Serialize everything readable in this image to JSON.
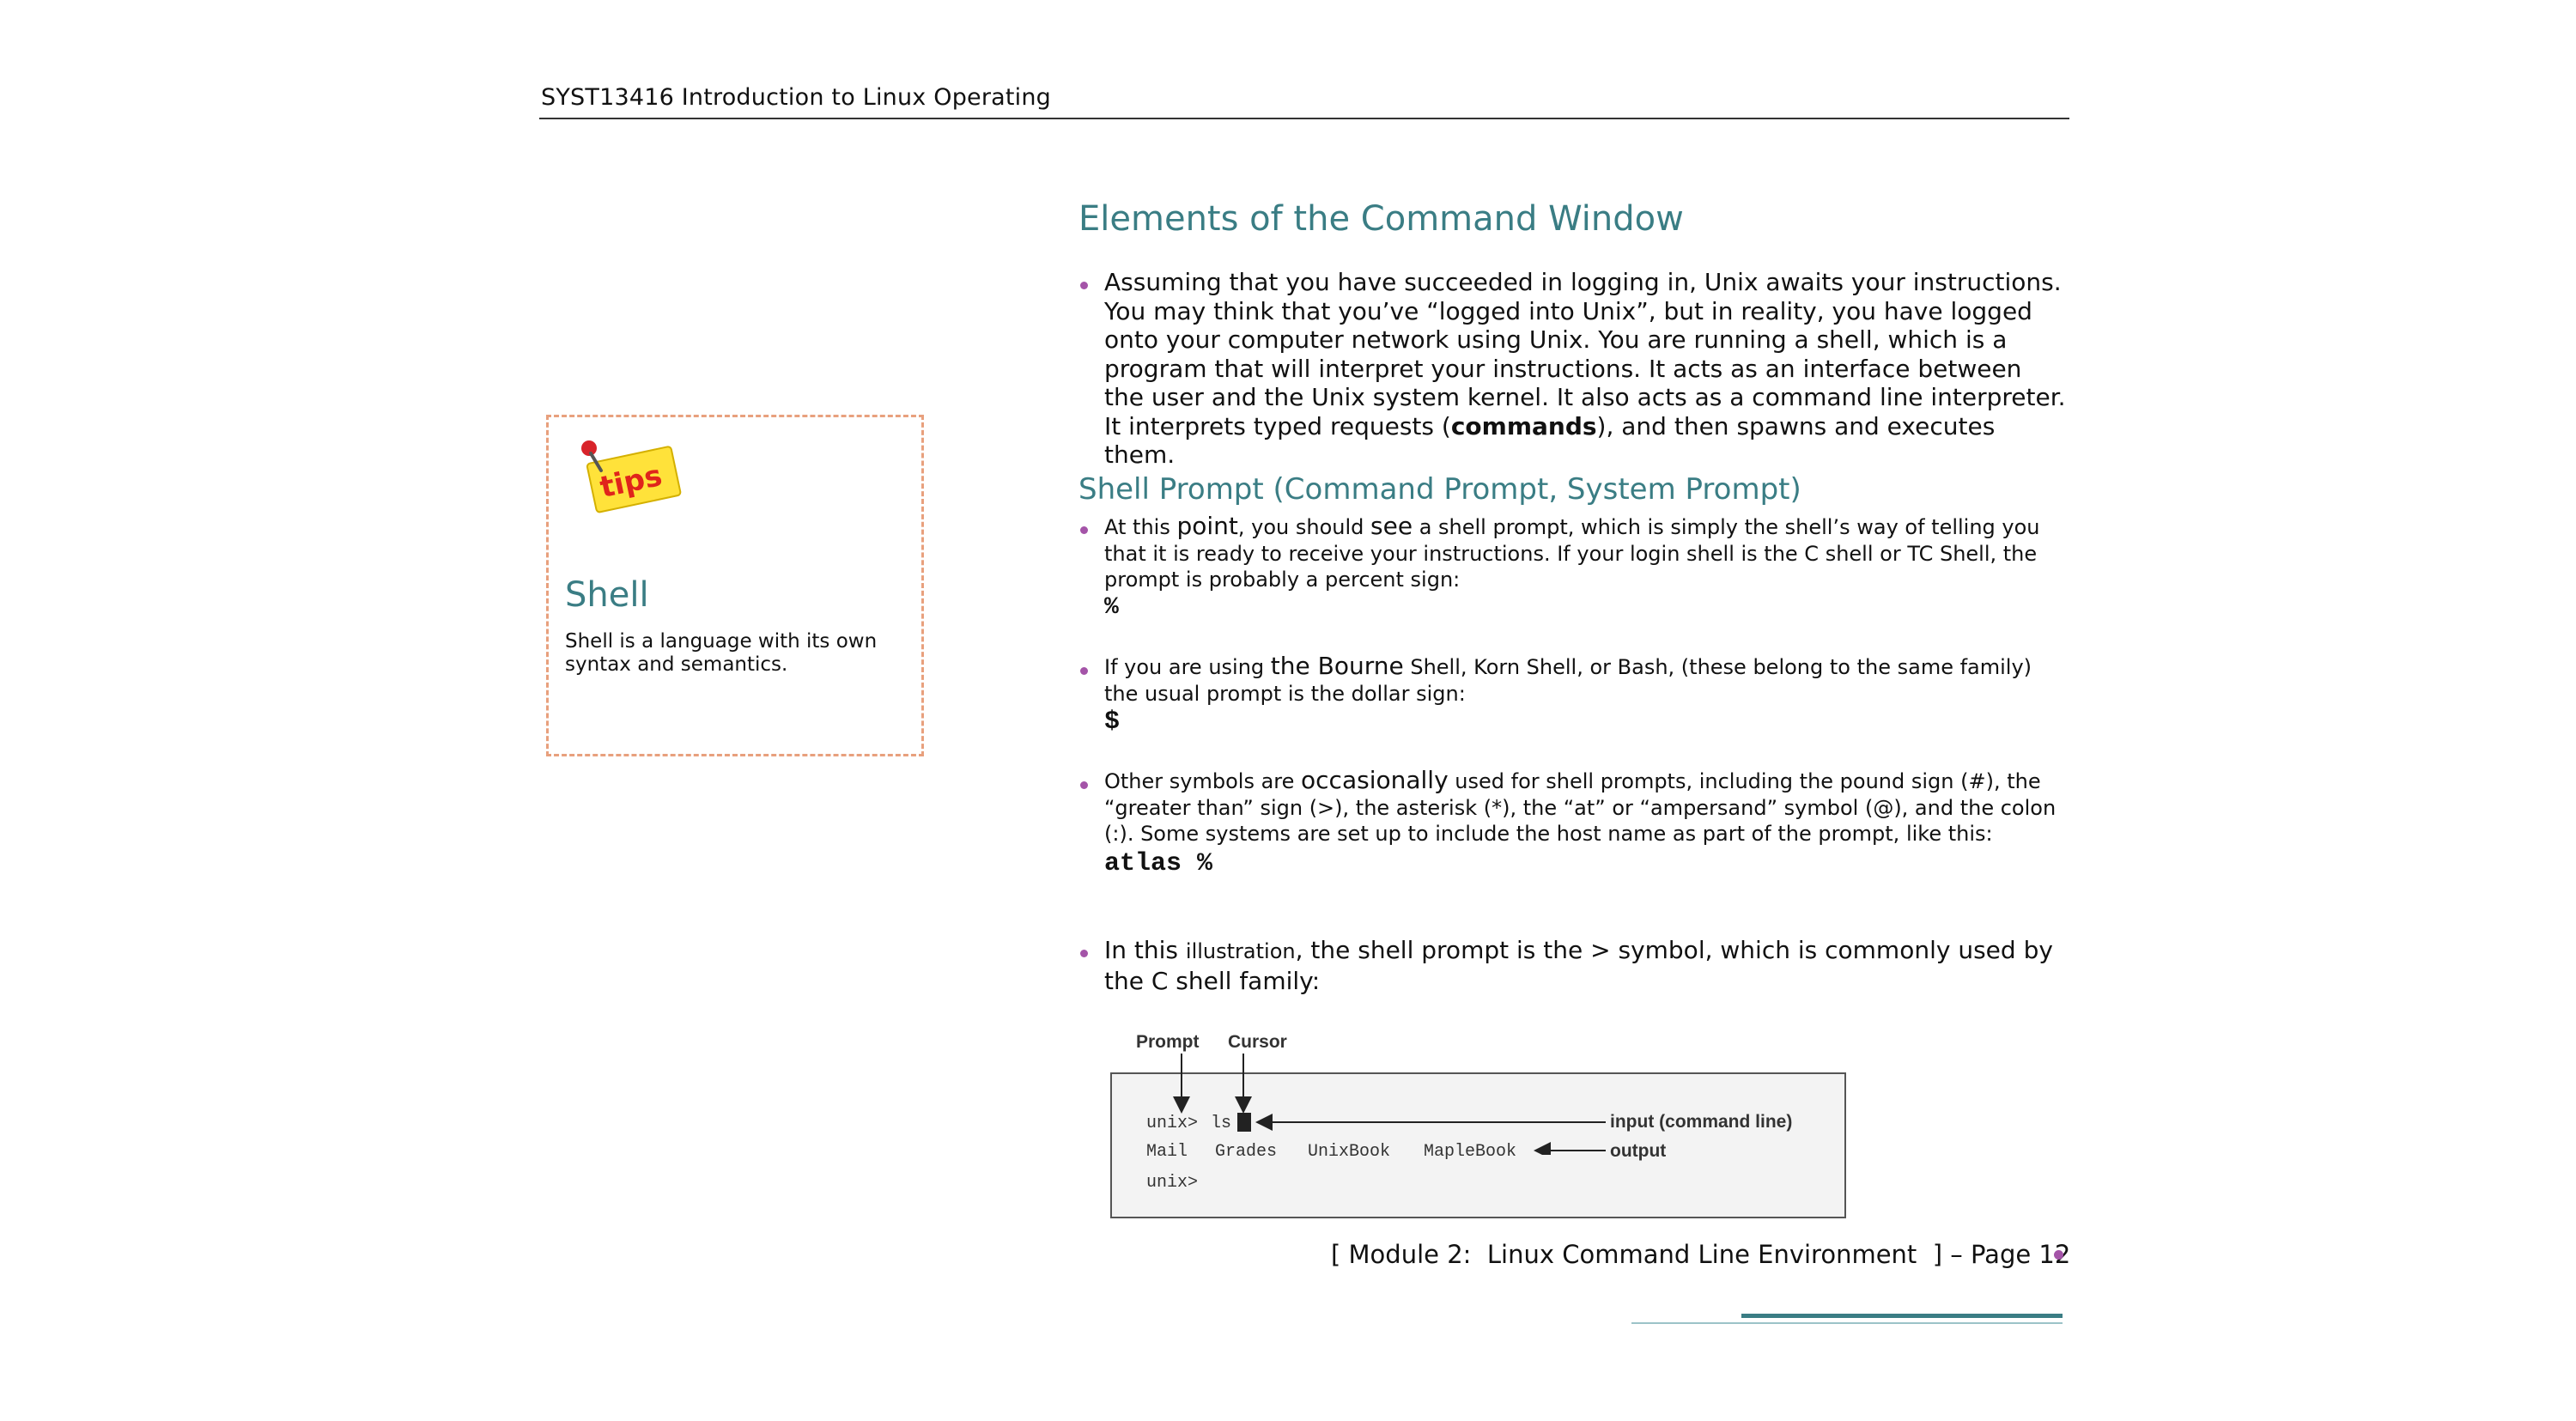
{
  "header": {
    "title": "SYST13416 Introduction to Linux Operating"
  },
  "sidebar": {
    "icon": "tips-sticky-note-icon",
    "icon_text": "tips",
    "heading": "Shell",
    "text": "Shell is a language with its own syntax and semantics."
  },
  "main": {
    "heading": "Elements of the Command Window",
    "intro": {
      "before": "Assuming that you have succeeded in logging in, Unix awaits your instructions. You may think that you’ve “logged into Unix”, but in reality, you have logged onto your computer network using Unix. You are running a shell, which is a program that will interpret your instructions. It acts as an interface between the user and the Unix system kernel. It also acts as a command line interpreter. It interprets typed requests (",
      "bold": "commands",
      "after": "), and then spawns and executes them."
    },
    "subheading": "Shell Prompt (Command Prompt, System Prompt)",
    "bullet1": {
      "t1": "At this ",
      "t2": "point",
      "t3": ", you should ",
      "t4": "see",
      "t5": " a shell prompt, which is simply the shell’s way of telling you that it is ready to receive your instructions. If your login shell is the C shell or TC Shell, the prompt is probably a percent sign:",
      "code": "%"
    },
    "bullet2": {
      "t1": "If you are using ",
      "t2": "the Bourne",
      "t3": " Shell, Korn Shell, or Bash, (these belong to the same family) the usual prompt is the dollar sign:",
      "code": "$"
    },
    "bullet3": {
      "t1": "Other symbols are ",
      "t2": "occasionally",
      "t3": " used for shell prompts, including the pound sign (#), the “greater than” sign (>), the asterisk (*), the “at”  or “ampersand” symbol (@), and the colon (:). Some systems are set up to include the host name as part of the prompt, like this:",
      "code": "atlas %"
    },
    "bullet4": {
      "t1": "In this ",
      "t2": "illustration",
      "t3": ", the shell prompt is the > symbol, which is commonly used by the C shell family:"
    }
  },
  "figure": {
    "label_prompt": "Prompt",
    "label_cursor": "Cursor",
    "line1_prompt": "unix>",
    "line1_cmd": "ls",
    "line2": [
      "Mail",
      "Grades",
      "UnixBook",
      "MapleBook"
    ],
    "line3": "unix>",
    "label_input": "input (command line)",
    "label_output": "output"
  },
  "footer": {
    "text": "[ Module 2:  Linux Command Line Environment  ] – Page 12"
  },
  "colors": {
    "heading": "#3a7d84",
    "bullet": "#a454a8",
    "tips_border": "#e8a07d"
  }
}
